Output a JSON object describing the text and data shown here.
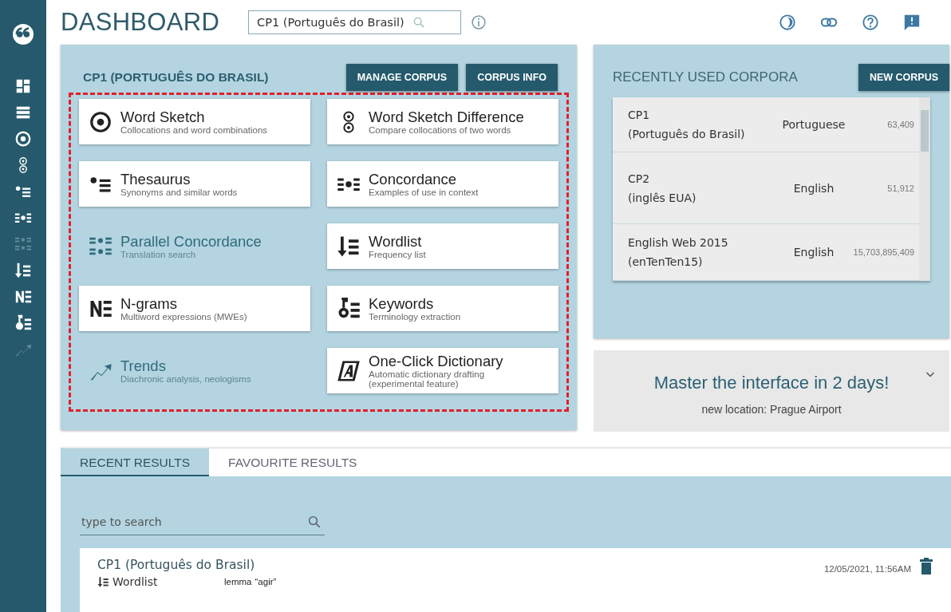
{
  "sidebar": {
    "items": [
      {
        "disabled": false
      },
      {
        "disabled": false
      },
      {
        "disabled": false
      },
      {
        "disabled": false
      },
      {
        "disabled": false
      },
      {
        "disabled": false
      },
      {
        "disabled": true
      },
      {
        "disabled": false
      },
      {
        "disabled": false
      },
      {
        "disabled": false
      },
      {
        "disabled": true
      }
    ]
  },
  "header": {
    "title": "DASHBOARD",
    "corpus_search": {
      "value": "CP1 (Português do Brasil)"
    }
  },
  "corpus_panel": {
    "title": "CP1 (PORTUGUÊS DO BRASIL)",
    "buttons": [
      "MANAGE CORPUS",
      "CORPUS INFO"
    ],
    "tools": [
      {
        "title": "Word Sketch",
        "subtitle": "Collocations and word combinations",
        "disabled": false
      },
      {
        "title": "Word Sketch Difference",
        "subtitle": "Compare collocations of two words",
        "disabled": false
      },
      {
        "title": "Thesaurus",
        "subtitle": "Synonyms and similar words",
        "disabled": false
      },
      {
        "title": "Concordance",
        "subtitle": "Examples of use in context",
        "disabled": false
      },
      {
        "title": "Parallel Concordance",
        "subtitle": "Translation search",
        "disabled": true
      },
      {
        "title": "Wordlist",
        "subtitle": "Frequency list",
        "disabled": false
      },
      {
        "title": "N-grams",
        "subtitle": "Multiword expressions (MWEs)",
        "disabled": false
      },
      {
        "title": "Keywords",
        "subtitle": "Terminology extraction",
        "disabled": false
      },
      {
        "title": "Trends",
        "subtitle": "Diachronic analysis, neologisms",
        "disabled": true
      },
      {
        "title": "One-Click Dictionary",
        "subtitle": "Automatic dictionary drafting (experimental feature)",
        "disabled": false
      }
    ]
  },
  "recent_corpora": {
    "title": "RECENTLY USED CORPORA",
    "button": "NEW CORPUS",
    "rows": [
      {
        "name": "CP1",
        "detail": "(Português do Brasil)",
        "language": "Portuguese",
        "size": "63,409"
      },
      {
        "name": "CP2",
        "detail": "(inglês EUA)",
        "language": "English",
        "size": "51,912"
      },
      {
        "name": "English Web 2015",
        "detail": "(enTenTen15)",
        "language": "English",
        "size": "15,703,895,409"
      }
    ]
  },
  "promo": {
    "title": "Master the interface in 2 days!",
    "subtitle": "new location: Prague Airport"
  },
  "results": {
    "tabs": [
      {
        "label": "RECENT RESULTS",
        "selected": true
      },
      {
        "label": "FAVOURITE RESULTS",
        "selected": false
      }
    ],
    "search": {
      "placeholder": "type to search"
    },
    "items": [
      {
        "corpus": "CP1 (Português do Brasil)",
        "tool": "Wordlist",
        "query_label": "lemma",
        "query": "“agir”",
        "time": "12/05/2021, 11:56AM"
      }
    ]
  }
}
